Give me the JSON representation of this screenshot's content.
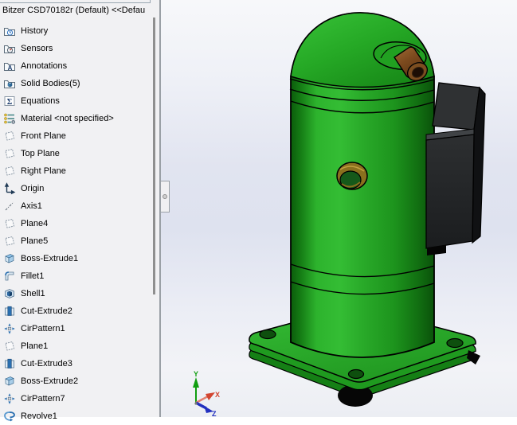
{
  "feature_tree": {
    "header": "Bitzer CSD70182r (Default) <<Defau",
    "items": [
      {
        "label": "History",
        "icon": "history-folder-icon"
      },
      {
        "label": "Sensors",
        "icon": "sensors-folder-icon"
      },
      {
        "label": "Annotations",
        "icon": "annotations-folder-icon"
      },
      {
        "label": "Solid Bodies(5)",
        "icon": "solid-bodies-folder-icon"
      },
      {
        "label": "Equations",
        "icon": "equations-icon"
      },
      {
        "label": "Material <not specified>",
        "icon": "material-icon"
      },
      {
        "label": "Front Plane",
        "icon": "plane-icon"
      },
      {
        "label": "Top Plane",
        "icon": "plane-icon"
      },
      {
        "label": "Right Plane",
        "icon": "plane-icon"
      },
      {
        "label": "Origin",
        "icon": "origin-icon"
      },
      {
        "label": "Axis1",
        "icon": "axis-icon"
      },
      {
        "label": "Plane4",
        "icon": "plane-icon"
      },
      {
        "label": "Plane5",
        "icon": "plane-icon"
      },
      {
        "label": "Boss-Extrude1",
        "icon": "boss-extrude-icon"
      },
      {
        "label": "Fillet1",
        "icon": "fillet-icon"
      },
      {
        "label": "Shell1",
        "icon": "shell-icon"
      },
      {
        "label": "Cut-Extrude2",
        "icon": "cut-extrude-icon"
      },
      {
        "label": "CirPattern1",
        "icon": "cirpattern-icon"
      },
      {
        "label": "Plane1",
        "icon": "plane-icon"
      },
      {
        "label": "Cut-Extrude3",
        "icon": "cut-extrude-icon"
      },
      {
        "label": "Boss-Extrude2",
        "icon": "boss-extrude-icon"
      },
      {
        "label": "CirPattern7",
        "icon": "cirpattern-icon"
      },
      {
        "label": "Revolve1",
        "icon": "revolve-icon"
      }
    ]
  },
  "viewport": {
    "triad": {
      "y_label": "Y",
      "x_label": "X",
      "z_label": "Z",
      "y_color": "#109e10",
      "x_color": "#d24530",
      "z_color": "#2230bf"
    },
    "model": {
      "body_color": "#23a423",
      "terminal_box_color": "#232527",
      "suction_port_color": "#8a701e",
      "discharge_pipe_color": "#7c4e20",
      "foot_color": "#060606"
    }
  }
}
